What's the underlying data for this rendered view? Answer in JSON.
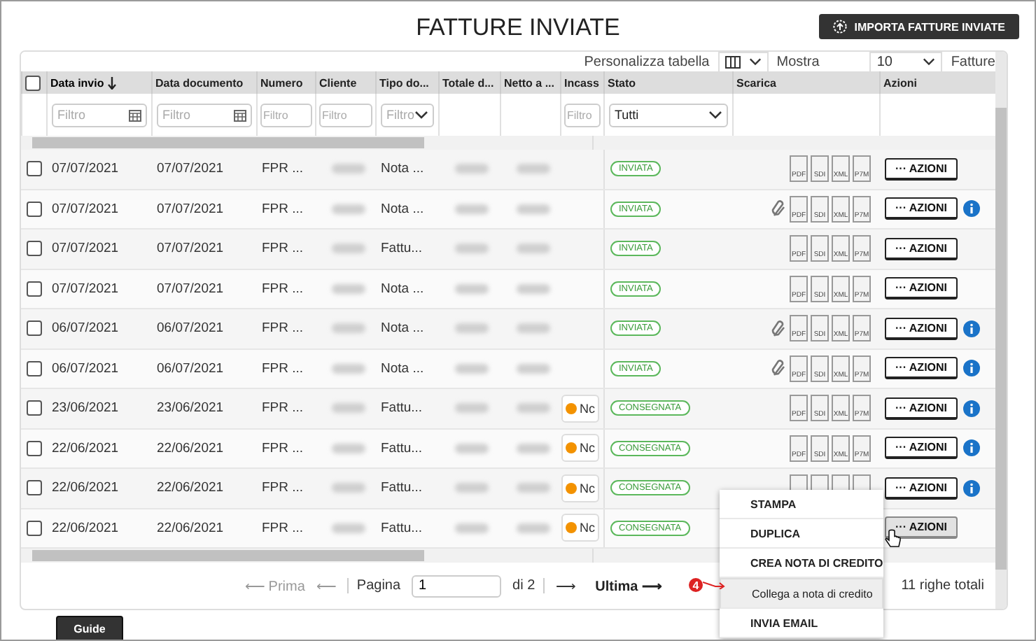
{
  "title": "FATTURE INVIATE",
  "import_button": "IMPORTA FATTURE INVIATE",
  "toolbar": {
    "customize_label": "Personalizza tabella",
    "show_label": "Mostra",
    "page_size": "10",
    "cut_label": "Fatture"
  },
  "all_checked": false,
  "columns": [
    {
      "label": "Data invio",
      "sorted": true,
      "filter": {
        "kind": "date",
        "placeholder": "Filtro"
      }
    },
    {
      "label": "Data documento",
      "sorted": false,
      "filter": {
        "kind": "date",
        "placeholder": "Filtro"
      }
    },
    {
      "label": "Numero",
      "sorted": false,
      "filter": {
        "kind": "text",
        "placeholder": "Filtro"
      }
    },
    {
      "label": "Cliente",
      "sorted": false,
      "filter": {
        "kind": "text",
        "placeholder": "Filtro"
      }
    },
    {
      "label": "Tipo do...",
      "sorted": false,
      "filter": {
        "kind": "select",
        "placeholder": "Filtro"
      }
    },
    {
      "label": "Totale d...",
      "sorted": false
    },
    {
      "label": "Netto a ...",
      "sorted": false
    },
    {
      "label": "Incass",
      "sorted": false,
      "filter": {
        "kind": "text",
        "placeholder": "Filtro"
      }
    },
    {
      "label": "Stato",
      "sorted": false,
      "filter": {
        "kind": "select",
        "value": "Tutti"
      }
    },
    {
      "label": "Scarica",
      "sorted": false
    },
    {
      "label": "Azioni",
      "sorted": false
    }
  ],
  "rows": [
    {
      "checked": false,
      "date_sent": "07/07/2021",
      "date_doc": "07/07/2021",
      "number": "FPR ...",
      "type": "Nota ...",
      "status": "INVIATA",
      "attachment": false,
      "downloads": [
        "PDF",
        "SDI",
        "XML",
        "P7M"
      ],
      "action": "··· AZIONI",
      "pressed": false,
      "info": false
    },
    {
      "checked": false,
      "date_sent": "07/07/2021",
      "date_doc": "07/07/2021",
      "number": "FPR ...",
      "type": "Nota ...",
      "status": "INVIATA",
      "attachment": true,
      "downloads": [
        "PDF",
        "SDI",
        "XML",
        "P7M"
      ],
      "action": "··· AZIONI",
      "pressed": false,
      "info": true
    },
    {
      "checked": false,
      "date_sent": "07/07/2021",
      "date_doc": "07/07/2021",
      "number": "FPR ...",
      "type": "Fattu...",
      "status": "INVIATA",
      "attachment": false,
      "downloads": [
        "PDF",
        "SDI",
        "XML",
        "P7M"
      ],
      "action": "··· AZIONI",
      "pressed": false,
      "info": false
    },
    {
      "checked": false,
      "date_sent": "07/07/2021",
      "date_doc": "07/07/2021",
      "number": "FPR ...",
      "type": "Nota ...",
      "status": "INVIATA",
      "attachment": false,
      "downloads": [
        "PDF",
        "SDI",
        "XML",
        "P7M"
      ],
      "action": "··· AZIONI",
      "pressed": false,
      "info": false
    },
    {
      "checked": false,
      "date_sent": "06/07/2021",
      "date_doc": "06/07/2021",
      "number": "FPR ...",
      "type": "Nota ...",
      "status": "INVIATA",
      "attachment": true,
      "downloads": [
        "PDF",
        "SDI",
        "XML",
        "P7M"
      ],
      "action": "··· AZIONI",
      "pressed": false,
      "info": true
    },
    {
      "checked": false,
      "date_sent": "06/07/2021",
      "date_doc": "06/07/2021",
      "number": "FPR ...",
      "type": "Nota ...",
      "status": "INVIATA",
      "attachment": true,
      "downloads": [
        "PDF",
        "SDI",
        "XML",
        "P7M"
      ],
      "action": "··· AZIONI",
      "pressed": false,
      "info": true
    },
    {
      "checked": false,
      "date_sent": "23/06/2021",
      "date_doc": "23/06/2021",
      "number": "FPR ...",
      "type": "Fattu...",
      "payment": "Nc",
      "status": "CONSEGNATA",
      "attachment": false,
      "downloads": [
        "PDF",
        "SDI",
        "XML",
        "P7M"
      ],
      "action": "··· AZIONI",
      "pressed": false,
      "info": true
    },
    {
      "checked": false,
      "date_sent": "22/06/2021",
      "date_doc": "22/06/2021",
      "number": "FPR ...",
      "type": "Fattu...",
      "payment": "Nc",
      "status": "CONSEGNATA",
      "attachment": false,
      "downloads": [
        "PDF",
        "SDI",
        "XML",
        "P7M"
      ],
      "action": "··· AZIONI",
      "pressed": false,
      "info": true
    },
    {
      "checked": false,
      "date_sent": "22/06/2021",
      "date_doc": "22/06/2021",
      "number": "FPR ...",
      "type": "Fattu...",
      "payment": "Nc",
      "status": "CONSEGNATA",
      "attachment": false,
      "files_covered": true,
      "action": "··· AZIONI",
      "pressed": false,
      "info": true
    },
    {
      "checked": false,
      "date_sent": "22/06/2021",
      "date_doc": "22/06/2021",
      "number": "FPR ...",
      "type": "Fattu...",
      "payment": "Nc",
      "status": "CONSEGNATA",
      "attachment": false,
      "action": "··· AZIONI",
      "pressed": true,
      "info": false
    }
  ],
  "pagination": {
    "first": "⟵ Prima",
    "prev": "⟵",
    "page_label": "Pagina",
    "page": "1",
    "of": "di 2",
    "next": "⟶",
    "last": "Ultima ⟶",
    "total": "11 righe totali"
  },
  "menu": [
    {
      "label": "STAMPA",
      "selected": false
    },
    {
      "label": "DUPLICA",
      "selected": false
    },
    {
      "label": "CREA NOTA DI CREDITO",
      "selected": false
    },
    {
      "label": "Collega a nota di credito",
      "selected": true
    },
    {
      "label": "INVIA EMAIL",
      "selected": false
    }
  ],
  "annotation": "4",
  "guide_tab": "Guide"
}
